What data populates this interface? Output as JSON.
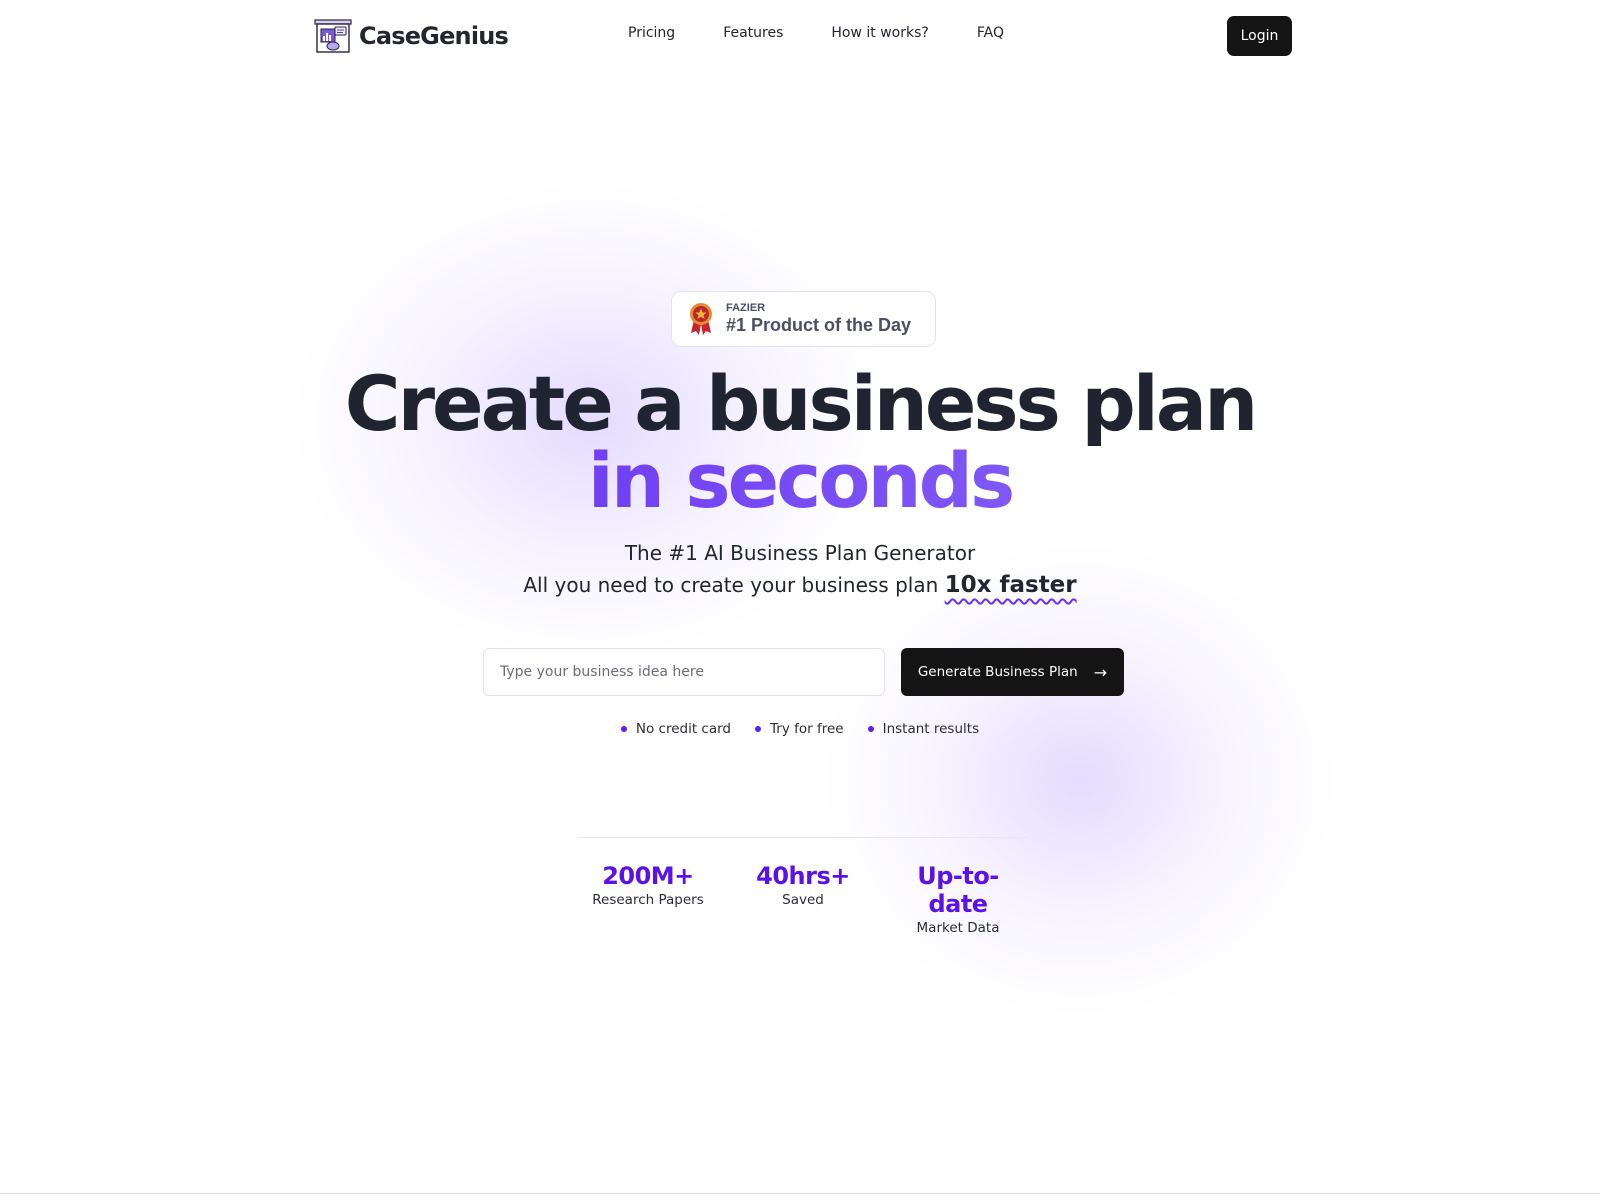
{
  "brand": {
    "name": "CaseGenius",
    "accent": "#5b12e6",
    "dark": "#141414"
  },
  "nav": {
    "links": [
      "Pricing",
      "Features",
      "How it works?",
      "FAQ"
    ],
    "login_label": "Login"
  },
  "badge": {
    "icon": "award-ribbon-icon",
    "source": "FAZIER",
    "title": "#1 Product of the Day"
  },
  "hero": {
    "headline_line1": "Create a business plan",
    "headline_line2": "in seconds",
    "subtitle_line1": "The #1 AI Business Plan Generator",
    "subtitle_line2_prefix": "All you need to create your business plan",
    "subtitle_line2_highlight": "10x faster"
  },
  "form": {
    "input_value": "",
    "input_placeholder": "Type your business idea here",
    "button_label": "Generate Business Plan",
    "button_icon": "arrow-right-icon"
  },
  "perks": [
    "No credit card",
    "Try for free",
    "Instant results"
  ],
  "stats": [
    {
      "value": "200M+",
      "label": "Research Papers"
    },
    {
      "value": "40hrs+",
      "label": "Saved"
    },
    {
      "value": "Up-to-date",
      "label": "Market Data"
    }
  ]
}
